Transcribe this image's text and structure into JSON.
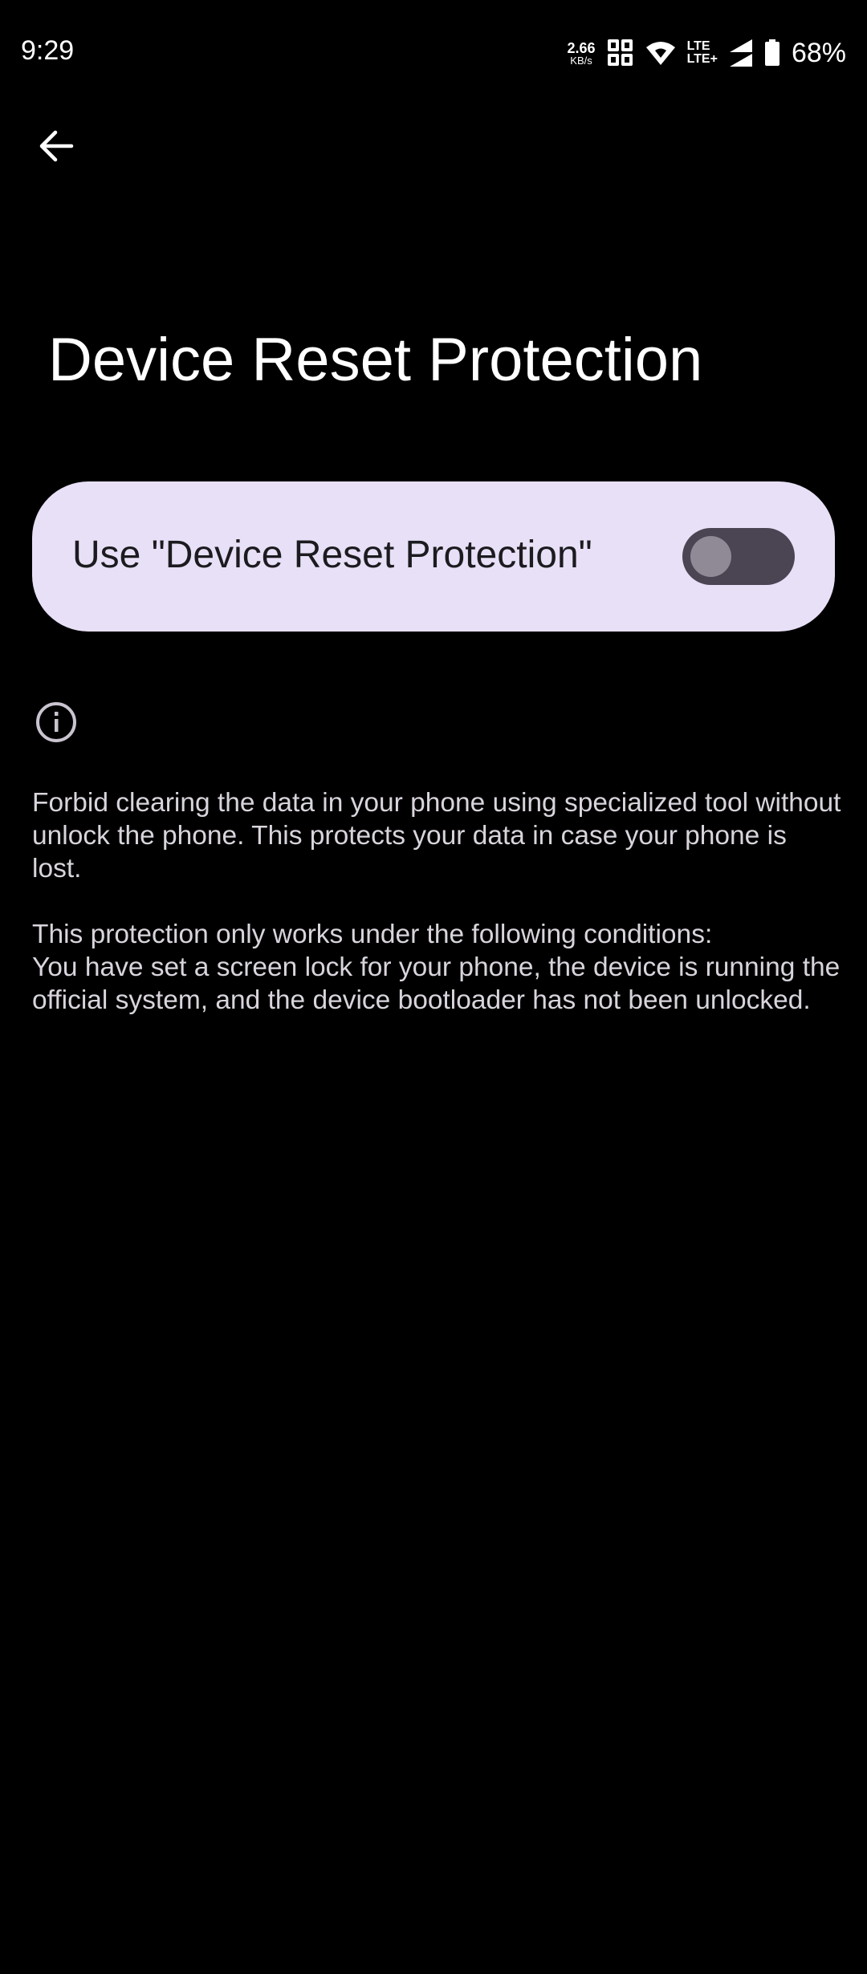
{
  "status_bar": {
    "time": "9:29",
    "net_speed_value": "2.66",
    "net_speed_unit": "KB/s",
    "lte_top": "LTE",
    "lte_bottom": "LTE+",
    "battery_percent": "68%",
    "icons": [
      "sim-hd-icon",
      "wifi-icon",
      "signal-icon",
      "battery-icon"
    ]
  },
  "header": {
    "back_icon": "arrow-back-icon"
  },
  "page": {
    "title": "Device Reset Protection"
  },
  "toggle": {
    "label": "Use \"Device Reset Protection\"",
    "state": "off"
  },
  "info": {
    "icon": "info-icon",
    "paragraph1": "Forbid clearing the data in your phone using specialized tool without unlock the phone. This protects your data in case your phone is lost.",
    "paragraph2_line1": "This protection only works under the following conditions:",
    "paragraph2_line2": "You have set a screen lock for your phone, the device is running the official system, and the device bootloader has not been unlocked."
  },
  "colors": {
    "background": "#000000",
    "card": "#e8e0f7",
    "switch_track": "#4a4453",
    "switch_thumb": "#8f8a95",
    "body_text": "#d9d4dc"
  }
}
